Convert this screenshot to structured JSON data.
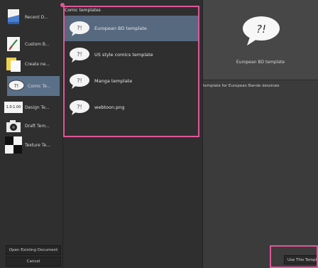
{
  "sidebar": {
    "items": [
      {
        "label": "Recent D..."
      },
      {
        "label": "Custom B..."
      },
      {
        "label": "Create ne..."
      },
      {
        "label": "Comic Te..."
      },
      {
        "label": "Design Te..."
      },
      {
        "label": "Draft Tem..."
      },
      {
        "label": "Texture Te..."
      }
    ],
    "selected_index": 3,
    "thumb_text_design": "1.0:1.00",
    "open_existing_label": "Open Existing Document",
    "cancel_label": "Cancel"
  },
  "templates": {
    "header": "Comic templates",
    "items": [
      {
        "label": "European BD template"
      },
      {
        "label": "US style comics template"
      },
      {
        "label": "Manga template"
      },
      {
        "label": "webtoon.png"
      }
    ],
    "selected_index": 0
  },
  "preview": {
    "bubble_text": "?!",
    "title": "European BD template",
    "description": "template for European Bande dessinée",
    "use_button_label": "Use This Template"
  },
  "colors": {
    "highlight": "#e0569a",
    "selection": "#56697f"
  }
}
